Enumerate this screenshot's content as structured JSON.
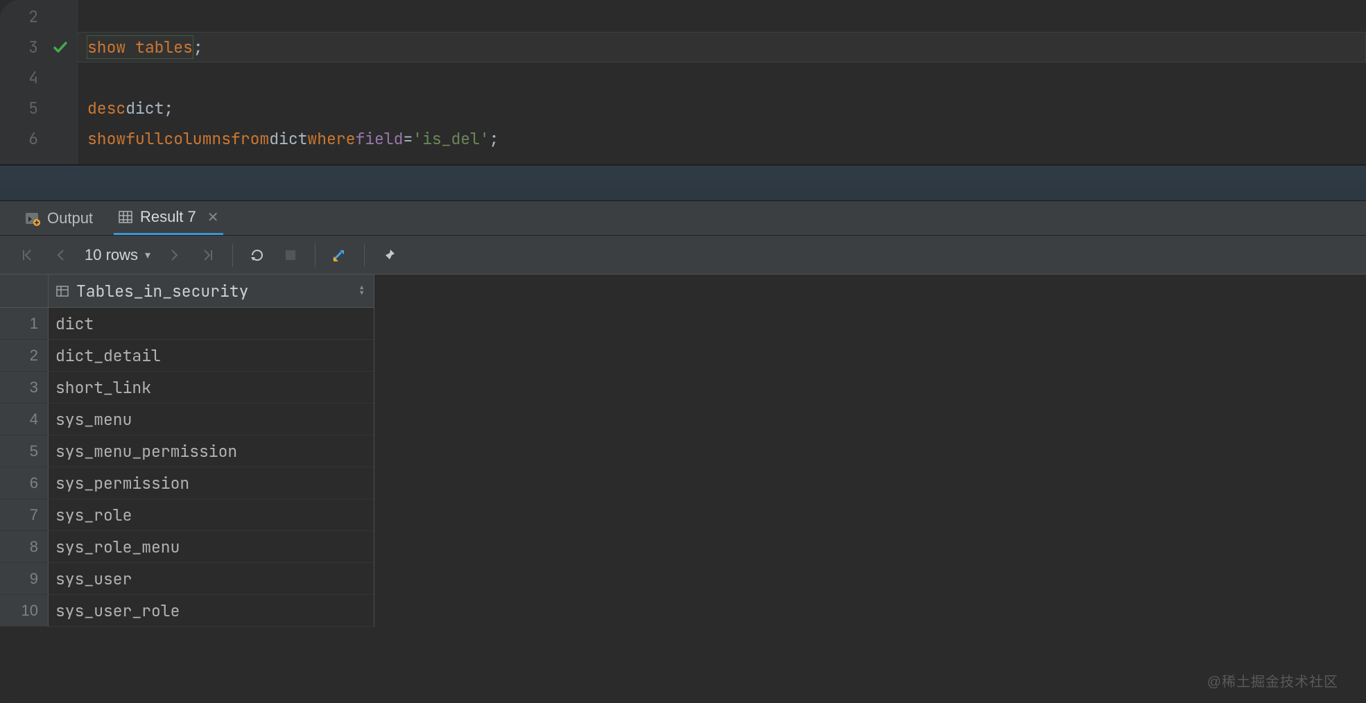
{
  "editor": {
    "lines": [
      {
        "num": "2",
        "marker": "",
        "tokens": []
      },
      {
        "num": "3",
        "marker": "check",
        "tokens": [
          {
            "t": "kw",
            "v": "show",
            "sel": true
          },
          {
            "t": "sp",
            "v": " "
          },
          {
            "t": "kw",
            "v": "tables",
            "sel": true
          },
          {
            "t": "punct",
            "v": ";"
          }
        ],
        "current": true
      },
      {
        "num": "4",
        "marker": "",
        "tokens": []
      },
      {
        "num": "5",
        "marker": "",
        "tokens": [
          {
            "t": "kw",
            "v": "desc"
          },
          {
            "t": "sp",
            "v": " "
          },
          {
            "t": "ident",
            "v": "dict"
          },
          {
            "t": "punct",
            "v": ";"
          }
        ]
      },
      {
        "num": "6",
        "marker": "",
        "tokens": [
          {
            "t": "kw",
            "v": "show"
          },
          {
            "t": "sp",
            "v": " "
          },
          {
            "t": "kw",
            "v": "full"
          },
          {
            "t": "sp",
            "v": " "
          },
          {
            "t": "kw",
            "v": "columns"
          },
          {
            "t": "sp",
            "v": " "
          },
          {
            "t": "kw",
            "v": "from"
          },
          {
            "t": "sp",
            "v": " "
          },
          {
            "t": "ident",
            "v": "dict"
          },
          {
            "t": "sp",
            "v": " "
          },
          {
            "t": "kw",
            "v": "where"
          },
          {
            "t": "sp",
            "v": " "
          },
          {
            "t": "col",
            "v": "field"
          },
          {
            "t": "sp",
            "v": " "
          },
          {
            "t": "op",
            "v": "="
          },
          {
            "t": "sp",
            "v": " "
          },
          {
            "t": "str",
            "v": "'is_del'"
          },
          {
            "t": "punct",
            "v": ";"
          }
        ]
      }
    ]
  },
  "tabs": {
    "output_label": "Output",
    "result_label": "Result 7"
  },
  "toolbar": {
    "rows_label": "10 rows"
  },
  "grid": {
    "column_header": "Tables_in_security",
    "rows": [
      "dict",
      "dict_detail",
      "short_link",
      "sys_menu",
      "sys_menu_permission",
      "sys_permission",
      "sys_role",
      "sys_role_menu",
      "sys_user",
      "sys_user_role"
    ]
  },
  "watermark": "@稀土掘金技术社区"
}
